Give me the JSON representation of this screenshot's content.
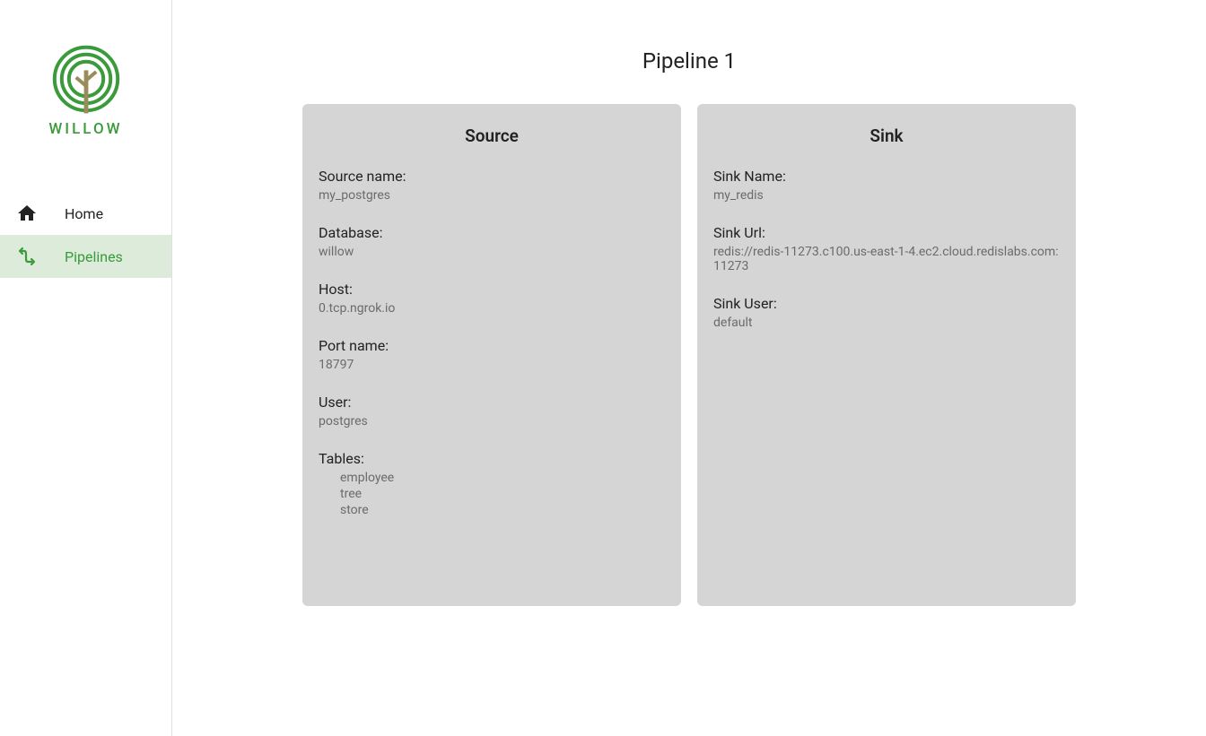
{
  "brand": {
    "name": "WILLOW"
  },
  "sidebar": {
    "items": [
      {
        "label": "Home",
        "icon": "home-icon",
        "active": false
      },
      {
        "label": "Pipelines",
        "icon": "pipelines-icon",
        "active": true
      }
    ]
  },
  "page": {
    "title": "Pipeline 1"
  },
  "source": {
    "card_title": "Source",
    "labels": {
      "source_name": "Source name:",
      "database": "Database:",
      "host": "Host:",
      "port_name": "Port name:",
      "user": "User:",
      "tables": "Tables:"
    },
    "source_name": "my_postgres",
    "database": "willow",
    "host": "0.tcp.ngrok.io",
    "port_name": "18797",
    "user": "postgres",
    "tables": [
      "employee",
      "tree",
      "store"
    ]
  },
  "sink": {
    "card_title": "Sink",
    "labels": {
      "sink_name": "Sink Name:",
      "sink_url": "Sink Url:",
      "sink_user": "Sink User:"
    },
    "sink_name": "my_redis",
    "sink_url": "redis://redis-11273.c100.us-east-1-4.ec2.cloud.redislabs.com:11273",
    "sink_user": "default"
  }
}
